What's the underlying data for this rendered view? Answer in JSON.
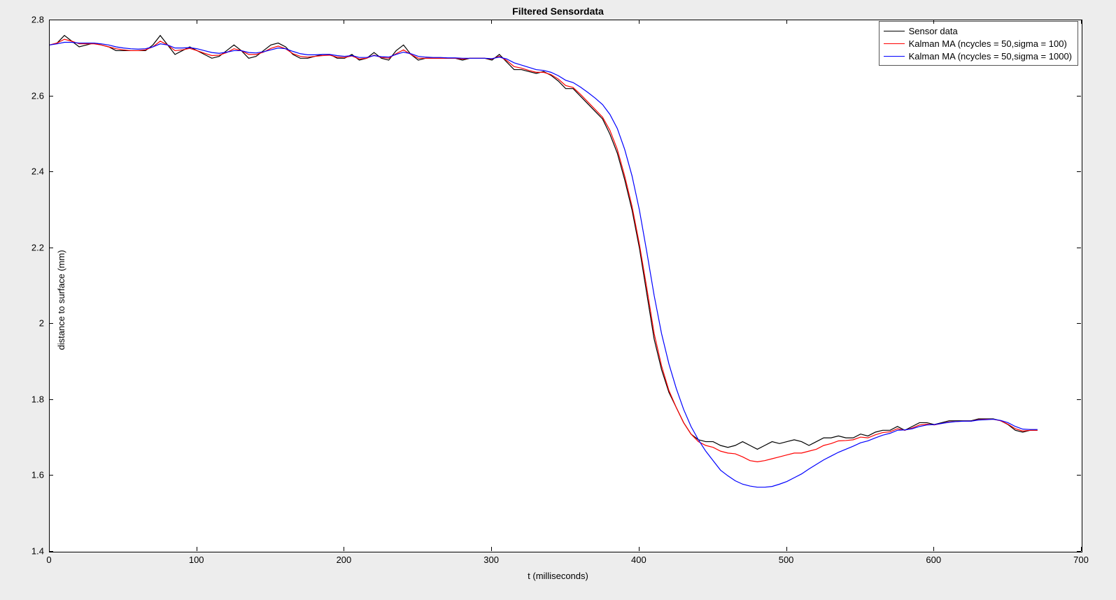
{
  "chart_data": {
    "type": "line",
    "title": "Filtered Sensordata",
    "xlabel": "t (milliseconds)",
    "ylabel": "distance to surface (mm)",
    "xlim": [
      0,
      700
    ],
    "ylim": [
      1.4,
      2.8
    ],
    "x_ticks": [
      0,
      100,
      200,
      300,
      400,
      500,
      600,
      700
    ],
    "y_ticks": [
      1.4,
      1.6,
      1.8,
      2.0,
      2.2,
      2.4,
      2.6,
      2.8
    ],
    "legend_position": "northeast",
    "series": [
      {
        "name": "Sensor data",
        "color": "#000000",
        "x": [
          0,
          5,
          10,
          15,
          20,
          25,
          30,
          35,
          40,
          45,
          50,
          55,
          60,
          65,
          70,
          75,
          80,
          85,
          90,
          95,
          100,
          105,
          110,
          115,
          120,
          125,
          130,
          135,
          140,
          145,
          150,
          155,
          160,
          165,
          170,
          175,
          180,
          185,
          190,
          195,
          200,
          205,
          210,
          215,
          220,
          225,
          230,
          235,
          240,
          245,
          250,
          255,
          260,
          265,
          270,
          275,
          280,
          285,
          290,
          295,
          300,
          305,
          310,
          315,
          320,
          325,
          330,
          335,
          340,
          345,
          350,
          355,
          360,
          365,
          370,
          375,
          380,
          385,
          390,
          395,
          400,
          405,
          410,
          415,
          420,
          425,
          430,
          435,
          440,
          445,
          450,
          455,
          460,
          465,
          470,
          475,
          480,
          485,
          490,
          495,
          500,
          505,
          510,
          515,
          520,
          525,
          530,
          535,
          540,
          545,
          550,
          555,
          560,
          565,
          570,
          575,
          580,
          585,
          590,
          595,
          600,
          605,
          610,
          615,
          620,
          625,
          630,
          635,
          640,
          645,
          650,
          655,
          660,
          665,
          670
        ],
        "values": [
          2.735,
          2.74,
          2.76,
          2.745,
          2.73,
          2.735,
          2.74,
          2.735,
          2.73,
          2.72,
          2.72,
          2.72,
          2.72,
          2.72,
          2.735,
          2.76,
          2.735,
          2.71,
          2.72,
          2.73,
          2.72,
          2.71,
          2.7,
          2.705,
          2.72,
          2.735,
          2.72,
          2.7,
          2.705,
          2.72,
          2.735,
          2.74,
          2.73,
          2.71,
          2.7,
          2.7,
          2.705,
          2.71,
          2.71,
          2.7,
          2.7,
          2.71,
          2.695,
          2.7,
          2.715,
          2.7,
          2.695,
          2.72,
          2.735,
          2.71,
          2.695,
          2.7,
          2.7,
          2.7,
          2.7,
          2.7,
          2.695,
          2.7,
          2.7,
          2.7,
          2.695,
          2.71,
          2.69,
          2.67,
          2.67,
          2.665,
          2.66,
          2.665,
          2.655,
          2.64,
          2.62,
          2.62,
          2.6,
          2.58,
          2.56,
          2.54,
          2.5,
          2.45,
          2.38,
          2.3,
          2.2,
          2.08,
          1.96,
          1.88,
          1.82,
          1.78,
          1.74,
          1.71,
          1.695,
          1.69,
          1.69,
          1.68,
          1.675,
          1.68,
          1.69,
          1.68,
          1.67,
          1.68,
          1.69,
          1.685,
          1.69,
          1.695,
          1.69,
          1.68,
          1.69,
          1.7,
          1.7,
          1.705,
          1.7,
          1.7,
          1.71,
          1.705,
          1.715,
          1.72,
          1.72,
          1.73,
          1.72,
          1.73,
          1.74,
          1.74,
          1.735,
          1.74,
          1.745,
          1.745,
          1.745,
          1.745,
          1.75,
          1.75,
          1.75,
          1.745,
          1.735,
          1.72,
          1.715,
          1.72,
          1.72
        ]
      },
      {
        "name": "Kalman MA (ncycles = 50,sigma = 100)",
        "color": "#ff0000",
        "x": [
          0,
          5,
          10,
          15,
          20,
          25,
          30,
          35,
          40,
          45,
          50,
          55,
          60,
          65,
          70,
          75,
          80,
          85,
          90,
          95,
          100,
          105,
          110,
          115,
          120,
          125,
          130,
          135,
          140,
          145,
          150,
          155,
          160,
          165,
          170,
          175,
          180,
          185,
          190,
          195,
          200,
          205,
          210,
          215,
          220,
          225,
          230,
          235,
          240,
          245,
          250,
          255,
          260,
          265,
          270,
          275,
          280,
          285,
          290,
          295,
          300,
          305,
          310,
          315,
          320,
          325,
          330,
          335,
          340,
          345,
          350,
          355,
          360,
          365,
          370,
          375,
          380,
          385,
          390,
          395,
          400,
          405,
          410,
          415,
          420,
          425,
          430,
          435,
          440,
          445,
          450,
          455,
          460,
          465,
          470,
          475,
          480,
          485,
          490,
          495,
          500,
          505,
          510,
          515,
          520,
          525,
          530,
          535,
          540,
          545,
          550,
          555,
          560,
          565,
          570,
          575,
          580,
          585,
          590,
          595,
          600,
          605,
          610,
          615,
          620,
          625,
          630,
          635,
          640,
          645,
          650,
          655,
          660,
          665,
          670
        ],
        "values": [
          2.735,
          2.74,
          2.75,
          2.745,
          2.738,
          2.738,
          2.738,
          2.735,
          2.73,
          2.725,
          2.722,
          2.72,
          2.72,
          2.722,
          2.73,
          2.745,
          2.735,
          2.72,
          2.722,
          2.726,
          2.72,
          2.713,
          2.707,
          2.708,
          2.715,
          2.725,
          2.72,
          2.71,
          2.71,
          2.716,
          2.726,
          2.732,
          2.725,
          2.712,
          2.705,
          2.703,
          2.705,
          2.707,
          2.708,
          2.703,
          2.702,
          2.706,
          2.698,
          2.7,
          2.708,
          2.702,
          2.7,
          2.712,
          2.722,
          2.71,
          2.7,
          2.7,
          2.7,
          2.7,
          2.7,
          2.7,
          2.698,
          2.7,
          2.7,
          2.7,
          2.698,
          2.705,
          2.694,
          2.678,
          2.674,
          2.668,
          2.663,
          2.663,
          2.657,
          2.645,
          2.628,
          2.623,
          2.605,
          2.585,
          2.565,
          2.545,
          2.51,
          2.46,
          2.39,
          2.31,
          2.21,
          2.095,
          1.975,
          1.89,
          1.825,
          1.78,
          1.74,
          1.71,
          1.69,
          1.68,
          1.675,
          1.665,
          1.66,
          1.658,
          1.65,
          1.64,
          1.637,
          1.64,
          1.645,
          1.65,
          1.655,
          1.66,
          1.66,
          1.665,
          1.67,
          1.68,
          1.685,
          1.692,
          1.693,
          1.695,
          1.702,
          1.7,
          1.708,
          1.714,
          1.716,
          1.724,
          1.72,
          1.726,
          1.734,
          1.736,
          1.734,
          1.738,
          1.742,
          1.743,
          1.744,
          1.744,
          1.748,
          1.749,
          1.749,
          1.745,
          1.736,
          1.724,
          1.718,
          1.72,
          1.72
        ]
      },
      {
        "name": "Kalman MA (ncycles = 50,sigma = 1000)",
        "color": "#0000ff",
        "x": [
          0,
          5,
          10,
          15,
          20,
          25,
          30,
          35,
          40,
          45,
          50,
          55,
          60,
          65,
          70,
          75,
          80,
          85,
          90,
          95,
          100,
          105,
          110,
          115,
          120,
          125,
          130,
          135,
          140,
          145,
          150,
          155,
          160,
          165,
          170,
          175,
          180,
          185,
          190,
          195,
          200,
          205,
          210,
          215,
          220,
          225,
          230,
          235,
          240,
          245,
          250,
          255,
          260,
          265,
          270,
          275,
          280,
          285,
          290,
          295,
          300,
          305,
          310,
          315,
          320,
          325,
          330,
          335,
          340,
          345,
          350,
          355,
          360,
          365,
          370,
          375,
          380,
          385,
          390,
          395,
          400,
          405,
          410,
          415,
          420,
          425,
          430,
          435,
          440,
          445,
          450,
          455,
          460,
          465,
          470,
          475,
          480,
          485,
          490,
          495,
          500,
          505,
          510,
          515,
          520,
          525,
          530,
          535,
          540,
          545,
          550,
          555,
          560,
          565,
          570,
          575,
          580,
          585,
          590,
          595,
          600,
          605,
          610,
          615,
          620,
          625,
          630,
          635,
          640,
          645,
          650,
          655,
          660,
          665,
          670
        ],
        "values": [
          2.735,
          2.738,
          2.742,
          2.742,
          2.74,
          2.74,
          2.74,
          2.738,
          2.735,
          2.73,
          2.727,
          2.725,
          2.724,
          2.725,
          2.73,
          2.738,
          2.735,
          2.727,
          2.727,
          2.728,
          2.725,
          2.72,
          2.715,
          2.713,
          2.716,
          2.72,
          2.72,
          2.715,
          2.714,
          2.717,
          2.722,
          2.727,
          2.725,
          2.718,
          2.712,
          2.709,
          2.709,
          2.71,
          2.71,
          2.707,
          2.705,
          2.707,
          2.702,
          2.702,
          2.707,
          2.704,
          2.703,
          2.71,
          2.716,
          2.712,
          2.705,
          2.703,
          2.702,
          2.702,
          2.701,
          2.701,
          2.7,
          2.7,
          2.7,
          2.7,
          2.699,
          2.703,
          2.698,
          2.688,
          2.682,
          2.676,
          2.67,
          2.668,
          2.663,
          2.654,
          2.642,
          2.636,
          2.624,
          2.61,
          2.595,
          2.578,
          2.552,
          2.515,
          2.46,
          2.39,
          2.3,
          2.19,
          2.075,
          1.975,
          1.895,
          1.83,
          1.775,
          1.73,
          1.695,
          1.665,
          1.64,
          1.615,
          1.6,
          1.587,
          1.578,
          1.573,
          1.57,
          1.57,
          1.572,
          1.578,
          1.585,
          1.595,
          1.605,
          1.618,
          1.63,
          1.642,
          1.652,
          1.662,
          1.67,
          1.678,
          1.687,
          1.692,
          1.7,
          1.707,
          1.712,
          1.72,
          1.721,
          1.724,
          1.73,
          1.734,
          1.735,
          1.738,
          1.741,
          1.743,
          1.744,
          1.744,
          1.747,
          1.748,
          1.749,
          1.746,
          1.74,
          1.73,
          1.723,
          1.722,
          1.722
        ]
      }
    ]
  }
}
